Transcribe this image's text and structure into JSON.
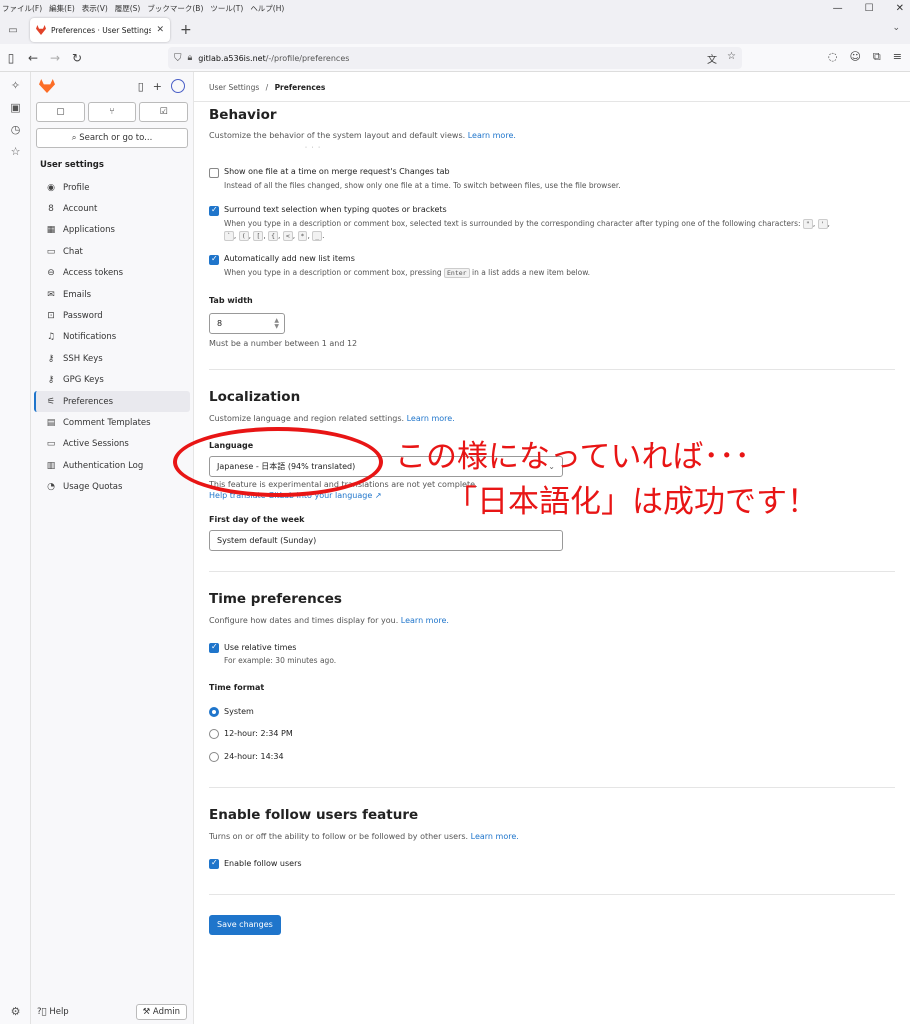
{
  "browser": {
    "menu": [
      "ファイル(F)",
      "編集(E)",
      "表示(V)",
      "履歴(S)",
      "ブックマーク(B)",
      "ツール(T)",
      "ヘルプ(H)"
    ],
    "tab_title": "Preferences · User Settings · GitL",
    "url_host": "gitlab.a536is.net",
    "url_path": "/-/profile/preferences"
  },
  "sidebar": {
    "search": "Search or go to...",
    "section": "User settings",
    "items": [
      {
        "label": "Profile",
        "icon": "user-icon"
      },
      {
        "label": "Account",
        "icon": "account-icon"
      },
      {
        "label": "Applications",
        "icon": "apps-icon"
      },
      {
        "label": "Chat",
        "icon": "chat-icon"
      },
      {
        "label": "Access tokens",
        "icon": "token-icon"
      },
      {
        "label": "Emails",
        "icon": "mail-icon"
      },
      {
        "label": "Password",
        "icon": "lock-icon"
      },
      {
        "label": "Notifications",
        "icon": "bell-icon"
      },
      {
        "label": "SSH Keys",
        "icon": "key-icon"
      },
      {
        "label": "GPG Keys",
        "icon": "key-icon"
      },
      {
        "label": "Preferences",
        "icon": "preferences-icon",
        "active": true
      },
      {
        "label": "Comment Templates",
        "icon": "comment-icon"
      },
      {
        "label": "Active Sessions",
        "icon": "monitor-icon"
      },
      {
        "label": "Authentication Log",
        "icon": "log-icon"
      },
      {
        "label": "Usage Quotas",
        "icon": "quota-icon"
      }
    ],
    "help": "Help",
    "admin": "Admin"
  },
  "breadcrumb": {
    "parent": "User Settings",
    "sep": "/",
    "current": "Preferences"
  },
  "behavior": {
    "title": "Behavior",
    "desc": "Customize the behavior of the system layout and default views.",
    "learn_more": "Learn more.",
    "opt1_label": "Show one file at a time on merge request's Changes tab",
    "opt1_help": "Instead of all the files changed, show only one file at a time. To switch between files, use the file browser.",
    "opt2_label": "Surround text selection when typing quotes or brackets",
    "opt2_help": "When you type in a description or comment box, selected text is surrounded by the corresponding character after typing one of the following characters:",
    "opt2_chars_a": [
      "\"",
      "'"
    ],
    "opt2_chars_b": [
      "`",
      "(",
      "[",
      "{",
      "<",
      "*",
      "_"
    ],
    "opt3_label": "Automatically add new list items",
    "opt3_help_a": "When you type in a description or comment box, pressing",
    "opt3_key": "Enter",
    "opt3_help_b": "in a list adds a new item below.",
    "tab_width_label": "Tab width",
    "tab_width_value": "8",
    "tab_width_help": "Must be a number between 1 and 12"
  },
  "localization": {
    "title": "Localization",
    "desc": "Customize language and region related settings.",
    "learn_more": "Learn more.",
    "language_label": "Language",
    "language_value": "Japanese - 日本語 (94% translated)",
    "experimental_note": "This feature is experimental and translations are not yet complete.",
    "help_translate": "Help translate GitLab into your language",
    "first_day_label": "First day of the week",
    "first_day_value": "System default (Sunday)"
  },
  "time": {
    "title": "Time preferences",
    "desc": "Configure how dates and times display for you.",
    "learn_more": "Learn more.",
    "relative_label": "Use relative times",
    "relative_help": "For example: 30 minutes ago.",
    "format_label": "Time format",
    "formats": [
      "System",
      "12-hour: 2:34 PM",
      "24-hour: 14:34"
    ]
  },
  "follow": {
    "title": "Enable follow users feature",
    "desc": "Turns on or off the ability to follow or be followed by other users.",
    "learn_more": "Learn more.",
    "checkbox_label": "Enable follow users"
  },
  "save_label": "Save changes",
  "annotation": {
    "line1": "この様になっていれば･･･",
    "line2": "「日本語化」は成功です！",
    "color": "#e81515"
  },
  "colors": {
    "accent": "#1f75cb",
    "brand": "#fc6d26"
  }
}
